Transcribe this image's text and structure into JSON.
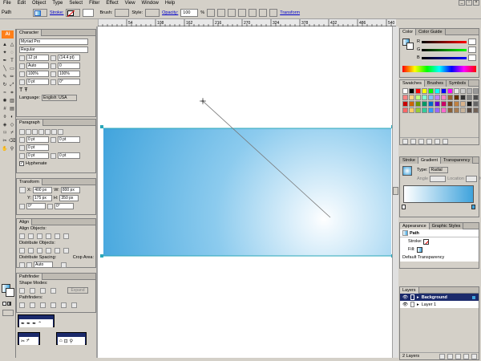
{
  "menu": [
    "File",
    "Edit",
    "Object",
    "Type",
    "Select",
    "Filter",
    "Effect",
    "View",
    "Window",
    "Help"
  ],
  "control": {
    "object_type": "Path",
    "stroke_label": "Stroke:",
    "brush_label": "Brush:",
    "style_label": "Style:",
    "opacity_label": "Opacity:",
    "opacity_value": "100",
    "opacity_unit": "%",
    "transform_link": "Transform"
  },
  "ruler_ticks": [
    "54",
    "108",
    "162",
    "216",
    "270",
    "324",
    "378",
    "432",
    "486",
    "540"
  ],
  "character": {
    "title": "Character",
    "font": "Myriad Pro",
    "style": "Regular",
    "size": "12 pt",
    "leading": "(14.4 pt)",
    "kerning": "Auto",
    "tracking": "0",
    "hscale": "100%",
    "vscale": "100%",
    "baseline": "0 pt",
    "rotation": "0°",
    "language_label": "Language:",
    "language": "English: USA"
  },
  "paragraph": {
    "title": "Paragraph",
    "left_indent": "0 pt",
    "right_indent": "0 pt",
    "first_indent": "0 pt",
    "space_before": "0 pt",
    "space_after": "0 pt",
    "hyphenate": "Hyphenate"
  },
  "transform": {
    "title": "Transform",
    "x_label": "X:",
    "x": "400 px",
    "y_label": "Y:",
    "y": "175 px",
    "w_label": "W:",
    "w": "800 px",
    "h_label": "H:",
    "h": "350 px",
    "angle": "0°",
    "shear": "0°"
  },
  "align": {
    "title": "Align",
    "align_objects": "Align Objects:",
    "distribute_objects": "Distribute Objects:",
    "distribute_spacing": "Distribute Spacing:",
    "align_to": "Crop Area:",
    "spacing_value": "Auto"
  },
  "pathfinder": {
    "title": "Pathfinder",
    "shape_modes": "Shape Modes:",
    "pathfinders": "Pathfinders:",
    "expand": "Expand"
  },
  "color": {
    "tabs": [
      "Color",
      "Color Guide"
    ],
    "r_label": "R",
    "g_label": "G",
    "b_label": "B"
  },
  "swatches": {
    "tabs": [
      "Swatches",
      "Brushes",
      "Symbols"
    ],
    "colors": [
      "#ffffff",
      "#000000",
      "#ff0000",
      "#ffff00",
      "#00ff00",
      "#00ffff",
      "#0000ff",
      "#ff00ff",
      "#e6e6e6",
      "#cccccc",
      "#b3b3b3",
      "#999999",
      "#ff8080",
      "#ffd080",
      "#c0ff80",
      "#80ffd0",
      "#80c0ff",
      "#c080ff",
      "#ff80c0",
      "#996633",
      "#663300",
      "#333333",
      "#808080",
      "#4d4d4d",
      "#cc0000",
      "#cc6600",
      "#669900",
      "#009966",
      "#0066cc",
      "#6600cc",
      "#cc0066",
      "#7a4a1f",
      "#c08040",
      "#d9b38c",
      "#1a1a1a",
      "#666666",
      "#ff6666",
      "#ffcc66",
      "#99cc33",
      "#33cc99",
      "#3399ff",
      "#9966ff",
      "#ff66cc",
      "#8c6239",
      "#a67c52",
      "#c7b299",
      "#594a42",
      "#736357"
    ]
  },
  "stroke_gradient": {
    "tabs": [
      "Stroke",
      "Gradient",
      "Transparency"
    ],
    "type_label": "Type:",
    "type": "Radial",
    "angle_label": "Angle",
    "location_label": "Location",
    "percent": "%"
  },
  "appearance": {
    "tabs": [
      "Appearance",
      "Graphic Styles"
    ],
    "header": "Path",
    "stroke_label": "Stroke:",
    "fill_label": "Fill:",
    "transparency": "Default Transparency"
  },
  "layers": {
    "tab": "Layers",
    "items": [
      "Background",
      "Layer 1"
    ],
    "count": "2 Layers"
  },
  "colors": {
    "gradient_start": "#ffffff",
    "gradient_end": "#3fa3dc",
    "selection": "#1b2a6b"
  }
}
